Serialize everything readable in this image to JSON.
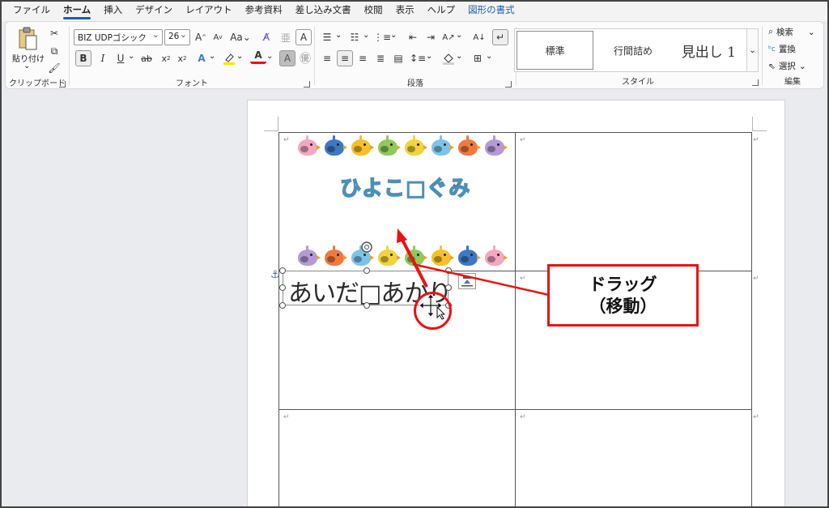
{
  "tabs": [
    "ファイル",
    "ホーム",
    "挿入",
    "デザイン",
    "レイアウト",
    "参考資料",
    "差し込み文書",
    "校閲",
    "表示",
    "ヘルプ",
    "図形の書式"
  ],
  "active_tab": "ホーム",
  "context_tab": "図形の書式",
  "ribbon": {
    "clipboard": {
      "paste_label": "貼り付け",
      "group_label": "クリップボード"
    },
    "font": {
      "font_name": "BIZ UDPゴシック",
      "font_size": "26",
      "case_label": "Aa",
      "group_label": "フォント"
    },
    "paragraph": {
      "group_label": "段落"
    },
    "styles": {
      "items": [
        "標準",
        "行間詰め",
        "見出し 1"
      ],
      "group_label": "スタイル"
    },
    "editing": {
      "find_label": "検索",
      "replace_label": "置換",
      "select_label": "選択",
      "group_label": "編集"
    }
  },
  "document": {
    "class_title": "ひよこ□ぐみ",
    "name_text": "あいだ□あかり",
    "para_mark": "↵"
  },
  "callout": {
    "line1": "ドラッグ",
    "line2": "（移動）"
  },
  "colors": {
    "accent": "#1e5fb3",
    "annotation_red": "#e11111",
    "bird_colors": [
      "#f4a7c0",
      "#3d78c4",
      "#f6c02a",
      "#8fc95a",
      "#f2d33c",
      "#7cc3ea",
      "#f07a3e",
      "#b49bd6"
    ],
    "bird_colors_row2": [
      "#b49bd6",
      "#f07a3e",
      "#7cc3ea",
      "#f2d33c",
      "#8fc95a",
      "#f6c02a",
      "#3d78c4",
      "#f4a7c0"
    ]
  }
}
